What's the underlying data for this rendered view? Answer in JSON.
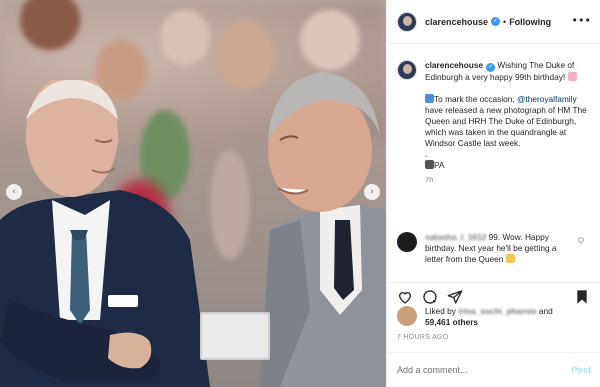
{
  "header": {
    "username": "clarencehouse",
    "separator": "•",
    "follow_status": "Following",
    "more_icon": "more-options-icon"
  },
  "caption": {
    "username": "clarencehouse",
    "intro": "Wishing The Duke of Edinburgh a very happy 99th birthday!",
    "body_prefix": "To mark the occasion, ",
    "mention": "@theroyalfamily",
    "body_suffix": " have released a new photograph of HM The Queen and HRH The Duke of Edinburgh, which was taken in the quandrangle at Windsor Castle last week.",
    "dot": ".",
    "credit": "PA",
    "time": "7h"
  },
  "comment": {
    "username": "natasha_l_1612",
    "text": " 99. Wow. Happy birthday. Next year he'll be getting a letter from the Queen"
  },
  "likes": {
    "prefix": "Liked by ",
    "username": "irina_sochi_pharnie",
    "middle": " and",
    "count": "59,461 others"
  },
  "timestamp": "7 HOURS AGO",
  "add_comment": {
    "placeholder": "Add a comment...",
    "post_label": "Post"
  },
  "colors": {
    "verified": "#3897f0",
    "link": "#00376b",
    "post_disabled": "#b2dffc",
    "muted": "#8e8e8e"
  }
}
